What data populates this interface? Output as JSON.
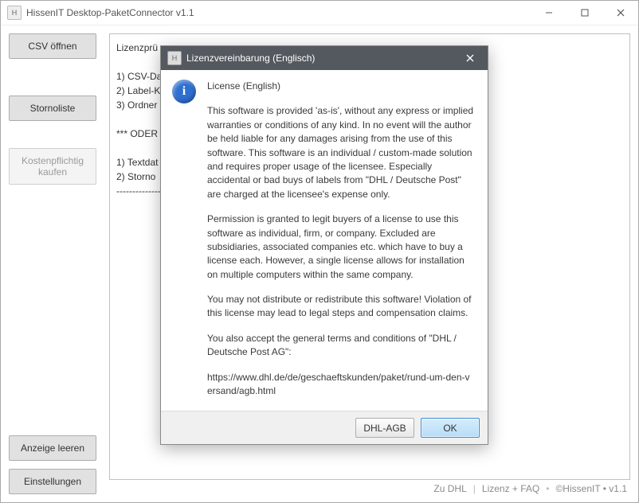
{
  "window": {
    "title": "HissenIT Desktop-PaketConnector v1.1"
  },
  "sidebar": {
    "csv_open": "CSV öffnen",
    "storno_list": "Stornoliste",
    "buy": "Kostenpflichtig\nkaufen",
    "clear": "Anzeige leeren",
    "settings": "Einstellungen"
  },
  "log": "Lizenzprü\n\n1) CSV-Da\n2) Label-K\n3) Ordner\n\n*** ODER\n\n1) Textdat\n2) Storno\n----------------",
  "footer": {
    "dhl": "Zu DHL",
    "license": "Lizenz + FAQ",
    "brand": "©HissenIT • v1.1"
  },
  "modal": {
    "title": "Lizenzvereinbarung (Englisch)",
    "heading": "License (English)",
    "p1": "This software is provided 'as-is', without any express or implied warranties or conditions of any kind. In no event will the author be held liable for any damages arising from the use of this software. This software is an individual / custom-made solution and requires proper usage of the licensee. Especially accidental or bad buys of labels from \"DHL / Deutsche Post\" are charged at the licensee's expense only.",
    "p2": "Permission is granted to legit buyers of a license to use this software as individual, firm, or company. Excluded are subsidiaries, associated companies etc. which have to buy a license each. However, a single license allows for installation on multiple computers within the same company.",
    "p3": "You may not distribute or redistribute this software! Violation of this license may lead to legal steps and compensation claims.",
    "p4": "You also accept the general terms and conditions of \"DHL / Deutsche Post AG\":",
    "url": "https://www.dhl.de/de/geschaeftskunden/paket/rund-um-den-versand/agb.html",
    "btn_agb": "DHL-AGB",
    "btn_ok": "OK"
  }
}
